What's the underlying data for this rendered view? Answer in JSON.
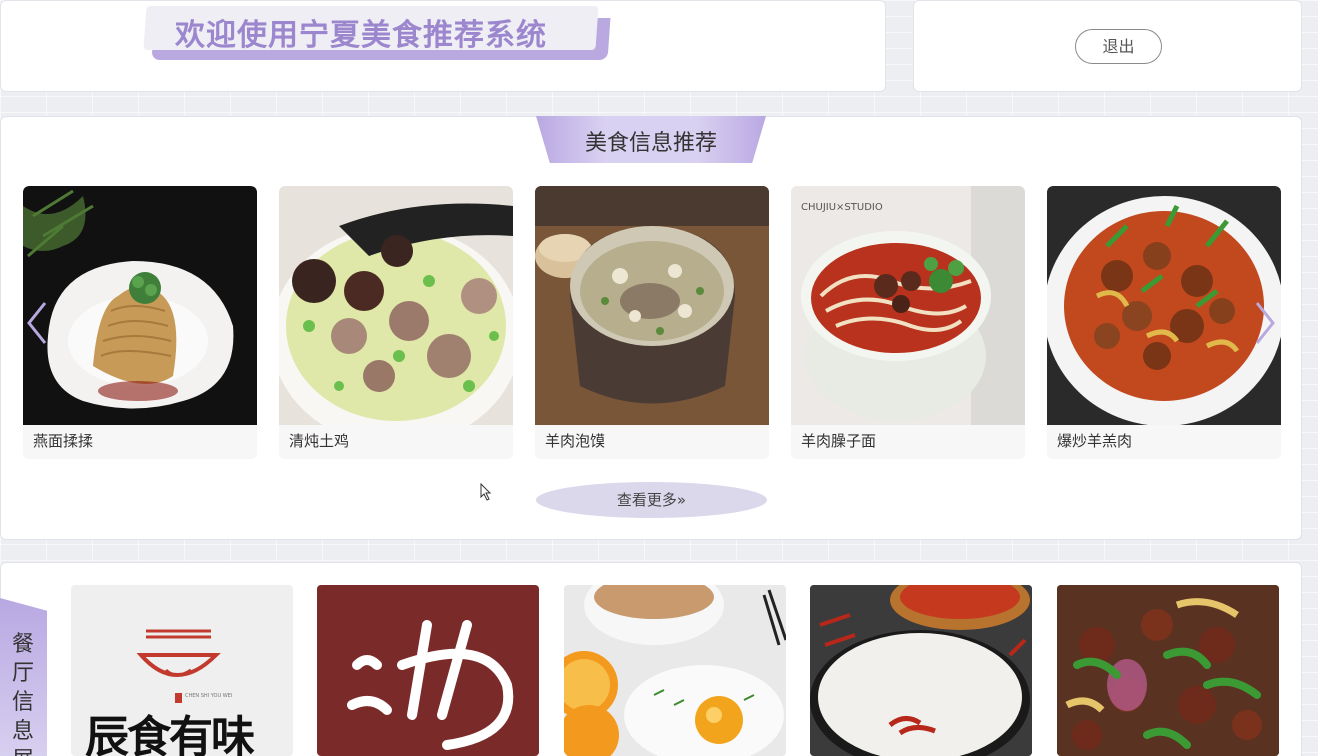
{
  "header": {
    "title": "欢迎使用宁夏美食推荐系统",
    "logout_label": "退出"
  },
  "recommend": {
    "section_title": "美食信息推荐",
    "more_label": "查看更多»",
    "items": [
      {
        "name": "燕面揉揉"
      },
      {
        "name": "清炖土鸡"
      },
      {
        "name": "羊肉泡馍"
      },
      {
        "name": "羊肉臊子面"
      },
      {
        "name": "爆炒羊羔肉"
      }
    ]
  },
  "restaurants": {
    "section_title": "餐厅信息展",
    "items": [
      {
        "logo_text": "辰食有味",
        "logo_sub": "CHEN SHI YOU WEI"
      },
      {
        "logo_text": "沩"
      },
      {
        "logo_text": ""
      },
      {
        "logo_text": ""
      },
      {
        "logo_text": ""
      }
    ]
  },
  "colors": {
    "accent_purple": "#9c87cf",
    "tab_purple": "#b9a8e2",
    "button_lavender": "#dcd8ec"
  }
}
